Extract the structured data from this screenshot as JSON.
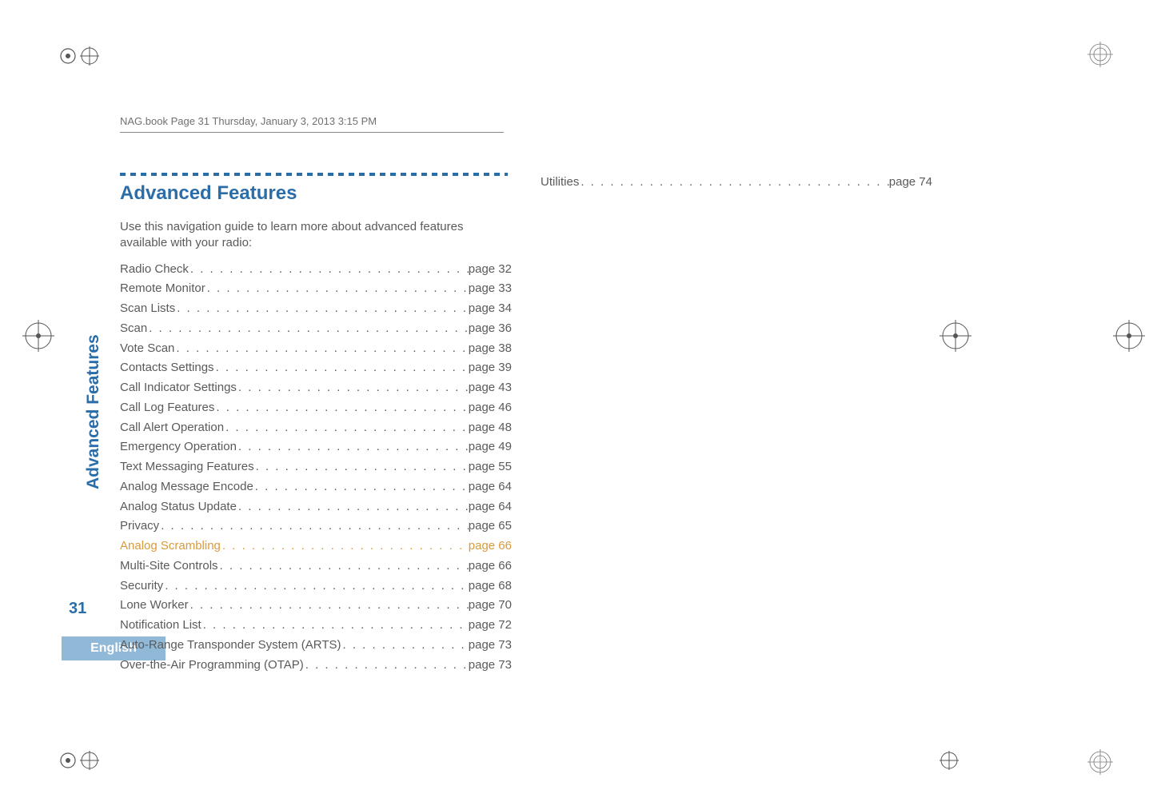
{
  "header": {
    "running_head": "NAG.book  Page 31  Thursday, January 3, 2013  3:15 PM"
  },
  "side": {
    "label": "Advanced Features",
    "page_number": "31",
    "language": "English"
  },
  "sectionTitle": "Advanced Features",
  "intro": "Use this navigation guide to learn more about advanced features available with your radio:",
  "toc_left": [
    {
      "label": "Radio Check",
      "page": "page 32",
      "hi": false
    },
    {
      "label": "Remote Monitor",
      "page": "page 33",
      "hi": false
    },
    {
      "label": "Scan Lists",
      "page": "page 34",
      "hi": false
    },
    {
      "label": "Scan",
      "page": "page 36",
      "hi": false
    },
    {
      "label": "Vote Scan",
      "page": "page 38",
      "hi": false
    },
    {
      "label": "Contacts Settings",
      "page": "page 39",
      "hi": false
    },
    {
      "label": "Call Indicator Settings",
      "page": "page 43",
      "hi": false
    },
    {
      "label": "Call Log Features",
      "page": "page 46",
      "hi": false
    },
    {
      "label": "Call Alert Operation",
      "page": "page 48",
      "hi": false
    },
    {
      "label": "Emergency Operation",
      "page": "page 49",
      "hi": false
    },
    {
      "label": "Text Messaging Features",
      "page": "page 55",
      "hi": false
    },
    {
      "label": "Analog Message Encode",
      "page": "page 64",
      "hi": false
    },
    {
      "label": "Analog Status Update",
      "page": "page 64",
      "hi": false
    },
    {
      "label": "Privacy",
      "page": "page 65",
      "hi": false
    },
    {
      "label": "Analog Scrambling",
      "page": "page 66",
      "hi": true
    },
    {
      "label": "Multi-Site Controls",
      "page": "page 66",
      "hi": false
    },
    {
      "label": "Security",
      "page": "page 68",
      "hi": false
    },
    {
      "label": "Lone Worker",
      "page": "page 70",
      "hi": false
    },
    {
      "label": "Notification List",
      "page": "page 72",
      "hi": false
    },
    {
      "label": "Auto-Range Transponder System (ARTS)",
      "page": "page 73",
      "hi": false
    },
    {
      "label": "Over-the-Air Programming (OTAP)",
      "page": "page 73",
      "hi": false
    }
  ],
  "toc_right": [
    {
      "label": "Utilities",
      "page": "page 74",
      "hi": false
    }
  ]
}
